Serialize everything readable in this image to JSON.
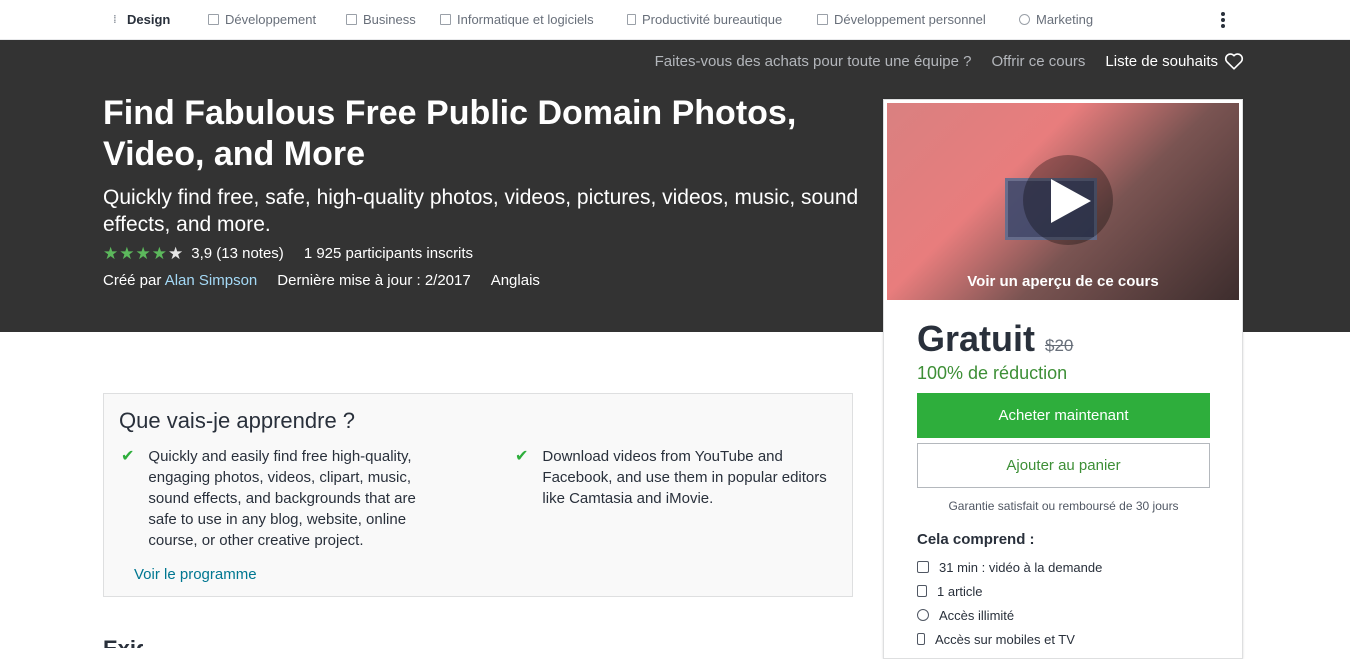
{
  "nav": {
    "categories": [
      {
        "label": "Design",
        "icon": "design-icon"
      },
      {
        "label": "Développement",
        "icon": "code-icon"
      },
      {
        "label": "Business",
        "icon": "chart-icon"
      },
      {
        "label": "Informatique et logiciels",
        "icon": "monitor-icon"
      },
      {
        "label": "Productivité bureautique",
        "icon": "document-icon"
      },
      {
        "label": "Développement personnel",
        "icon": "book-icon"
      },
      {
        "label": "Marketing",
        "icon": "megaphone-icon"
      }
    ],
    "more_icon": "more-vertical-icon"
  },
  "header": {
    "team_link": "Faites-vous des achats pour toute une équipe ?",
    "gift_link": "Offrir ce cours",
    "wishlist": "Liste de souhaits",
    "title": "Find Fabulous Free Public Domain Photos, Video, and More",
    "subtitle": "Quickly find free, safe, high-quality photos, videos, pictures, videos, music, sound effects, and more.",
    "rating_value": "3,9 (13 notes)",
    "rating_stars": 3.9,
    "students": "1 925 participants inscrits",
    "created_by_label": "Créé par",
    "author": "Alan Simpson",
    "updated": "Dernière mise à jour : 2/2017",
    "language": "Anglais"
  },
  "sidebar": {
    "preview_label": "Voir un aperçu de ce cours",
    "price": "Gratuit",
    "old_price": "$20",
    "discount": "100% de réduction",
    "buy_label": "Acheter maintenant",
    "cart_label": "Ajouter au panier",
    "guarantee": "Garantie satisfait ou remboursé de 30 jours",
    "includes_title": "Cela comprend :",
    "includes": [
      {
        "label": "31 min : vidéo à la demande",
        "icon": "video-icon"
      },
      {
        "label": "1 article",
        "icon": "file-icon"
      },
      {
        "label": "Accès illimité",
        "icon": "infinity-icon"
      },
      {
        "label": "Accès sur mobiles et TV",
        "icon": "mobile-icon"
      }
    ],
    "accent_green": "#2eae3c"
  },
  "learn": {
    "title": "Que vais-je apprendre ?",
    "items": [
      "Quickly and easily find free high-quality, engaging photos, videos, clipart, music, sound effects, and backgrounds that are safe to use in any blog, website, online course, or other creative project.",
      "Download videos from YouTube and Facebook, and use them in popular editors like Camtasia and iMovie."
    ],
    "program_link": "Voir le programme"
  },
  "next_section_heading": "Exigences"
}
